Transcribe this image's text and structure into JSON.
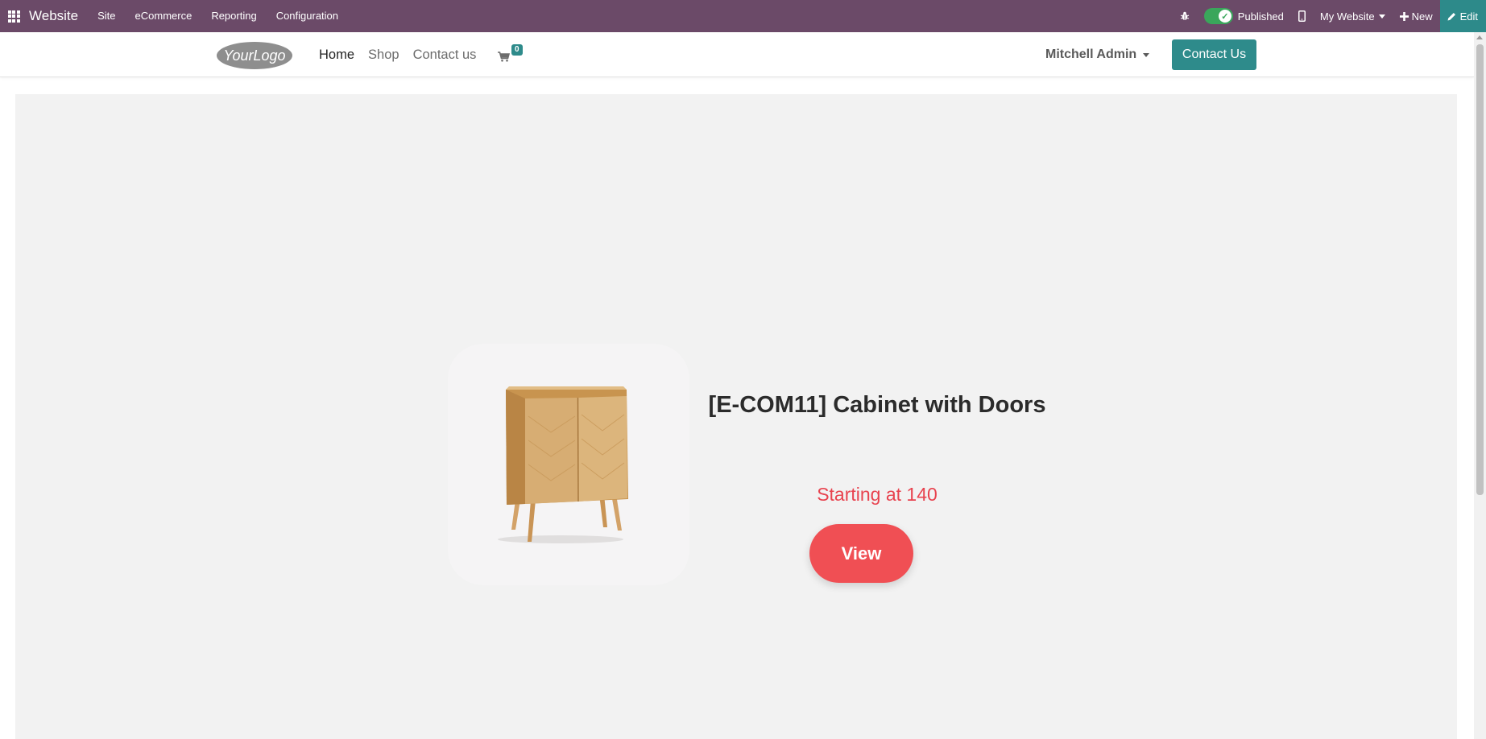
{
  "admin_bar": {
    "app_name": "Website",
    "menu": [
      "Site",
      "eCommerce",
      "Reporting",
      "Configuration"
    ],
    "publish_status": "Published",
    "website_selector": "My Website",
    "new_label": "New",
    "edit_label": "Edit",
    "icons": [
      "apps-grid-icon",
      "bug-icon",
      "mobile-icon",
      "plus-icon",
      "pencil-icon",
      "check-icon"
    ],
    "color": "#6b4a68"
  },
  "header": {
    "logo_text": "YourLogo",
    "nav": [
      {
        "label": "Home",
        "active": true
      },
      {
        "label": "Shop",
        "active": false
      },
      {
        "label": "Contact us",
        "active": false
      }
    ],
    "cart_count": "0",
    "user_name": "Mitchell Admin",
    "contact_button": "Contact Us",
    "accent_color": "#2e8b8b"
  },
  "product": {
    "title": "[E-COM11] Cabinet with Doors",
    "price": "Starting at 140",
    "view_button": "View",
    "image": "wooden-cabinet-image",
    "price_color": "#e8434f"
  }
}
